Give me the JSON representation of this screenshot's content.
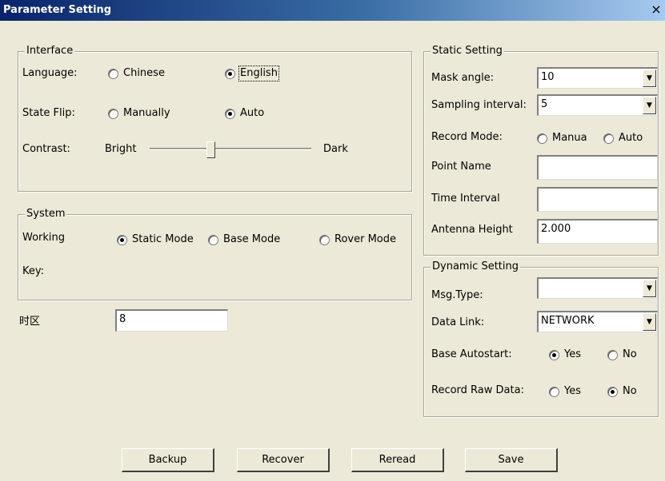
{
  "window": {
    "title": "Parameter Setting",
    "close": "×"
  },
  "interface": {
    "legend": "Interface",
    "language_label": "Language:",
    "lang_chinese": "Chinese",
    "lang_english": "English",
    "language_selected": "English",
    "flip_label": "State Flip:",
    "flip_manual": "Manually",
    "flip_auto": "Auto",
    "flip_selected": "Auto",
    "contrast_label": "Contrast:",
    "contrast_bright": "Bright",
    "contrast_dark": "Dark",
    "contrast_value": 0.38
  },
  "system": {
    "legend": "System",
    "working_label": "Working",
    "mode_static": "Static Mode",
    "mode_base": "Base Mode",
    "mode_rover": "Rover Mode",
    "mode_selected": "Static Mode",
    "key_label": "Key:"
  },
  "timezone": {
    "label": "时区",
    "value": "8"
  },
  "static": {
    "legend": "Static Setting",
    "mask_label": "Mask angle:",
    "mask_value": "10",
    "sampling_label": "Sampling interval:",
    "sampling_value": "5",
    "record_label": "Record Mode:",
    "record_manual": "Manua",
    "record_auto": "Auto",
    "point_label": "Point Name",
    "point_value": "",
    "time_label": "Time Interval",
    "time_value": "",
    "antenna_label": "Antenna Height",
    "antenna_value": "2.000"
  },
  "dynamic": {
    "legend": "Dynamic Setting",
    "msg_label": "Msg.Type:",
    "msg_value": "",
    "link_label": "Data Link:",
    "link_value": "NETWORK",
    "autostart_label": "Base Autostart:",
    "autostart_yes": "Yes",
    "autostart_no": "No",
    "autostart_selected": "Yes",
    "raw_label": "Record Raw Data:",
    "raw_yes": "Yes",
    "raw_no": "No",
    "raw_selected": "No"
  },
  "buttons": {
    "backup": "Backup",
    "recover": "Recover",
    "reread": "Reread",
    "save": "Save"
  }
}
